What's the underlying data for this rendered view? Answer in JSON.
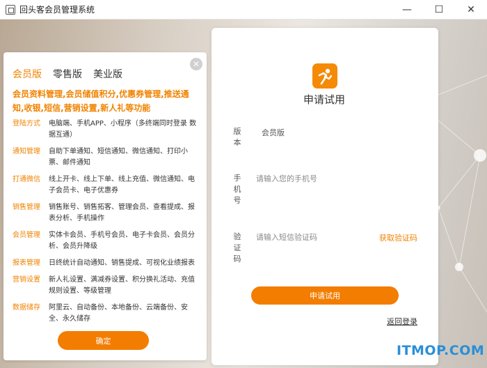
{
  "window": {
    "title": "回头客会员管理系统",
    "controls": {
      "minimize": "—",
      "maximize": "☐",
      "close": "✕"
    }
  },
  "left_panel": {
    "close_symbol": "✕",
    "tabs": [
      {
        "label": "会员版",
        "active": true
      },
      {
        "label": "零售版",
        "active": false
      },
      {
        "label": "美业版",
        "active": false
      }
    ],
    "headline": "会员资料管理,会员储值积分,优惠券管理,推送通知,收银,短信,营销设置,新人礼等功能",
    "features": [
      {
        "label": "登陆方式",
        "text": "电脑端、手机APP、小程序（多终端同时登录 数据互通）"
      },
      {
        "label": "通知管理",
        "text": "自助下单通知、短信通知、微信通知、打印小票、邮件通知"
      },
      {
        "label": "打通微信",
        "text": "线上开卡、线上下单、线上充值、微信通知、电子会员卡、电子优惠券"
      },
      {
        "label": "销售管理",
        "text": "销售账号、销售拓客、管理会员、查看提成、报表分析、手机操作"
      },
      {
        "label": "会员管理",
        "text": "实体卡会员、手机号会员、电子卡会员、会员分析、会员升降级"
      },
      {
        "label": "报表管理",
        "text": "日终统计自动通知、销售提成、可视化业绩报表"
      },
      {
        "label": "营销设置",
        "text": "新人礼设置、满减券设置、积分换礼活动、充值规则设置、等级管理"
      },
      {
        "label": "数据储存",
        "text": "阿里云、自动备份、本地备份、云端备份、安全、永久储存"
      }
    ],
    "confirm_label": "确定"
  },
  "form": {
    "title": "申请试用",
    "version_label": [
      "版",
      "本"
    ],
    "version_value": "会员版",
    "phone_label": [
      "手",
      "机",
      "号"
    ],
    "phone_placeholder": "请输入您的手机号",
    "code_label": [
      "验",
      "证",
      "码"
    ],
    "code_placeholder": "请输入短信验证码",
    "get_code_label": "获取验证码",
    "submit_label": "申请试用",
    "back_label": "返回登录"
  },
  "watermark": "ITMOP.COM",
  "colors": {
    "accent": "#f27d00",
    "watermark": "#2a8fd8"
  },
  "icons": {
    "logo": "runner-logo-icon",
    "close": "close-icon"
  }
}
